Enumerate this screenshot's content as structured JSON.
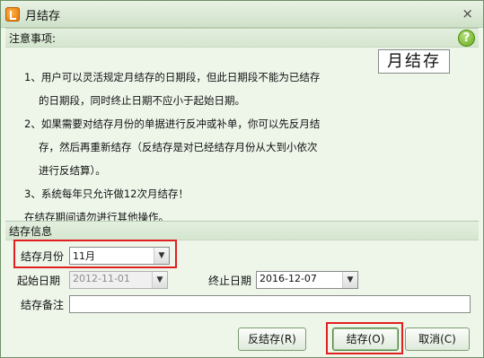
{
  "window": {
    "title": "月结存",
    "close_glyph": "×"
  },
  "notice": {
    "header": "注意事项:",
    "help_glyph": "?",
    "logo_text": "月结存",
    "lines": [
      "1、用户可以灵活规定月结存的日期段，但此日期段不能为已结存",
      "的日期段，同时终止日期不应小于起始日期。",
      "2、如果需要对结存月份的单据进行反冲或补单，你可以先反月结",
      "存，然后再重新结存（反结存是对已经结存月份从大到小依次",
      "进行反结算）。",
      "3、系统每年只允许做12次月结存！",
      "在结存期间请勿进行其他操作。"
    ]
  },
  "info": {
    "header": "结存信息",
    "month_label": "结存月份",
    "month_value": "11月",
    "start_label": "起始日期",
    "start_value": "2012-11-01",
    "end_label": "终止日期",
    "end_value": "2016-12-07",
    "remark_label": "结存备注",
    "remark_value": ""
  },
  "buttons": {
    "reverse": "反结存(R)",
    "settle": "结存(O)",
    "cancel": "取消(C)"
  },
  "colors": {
    "highlight": "#e02020",
    "help": "#5ea419"
  }
}
